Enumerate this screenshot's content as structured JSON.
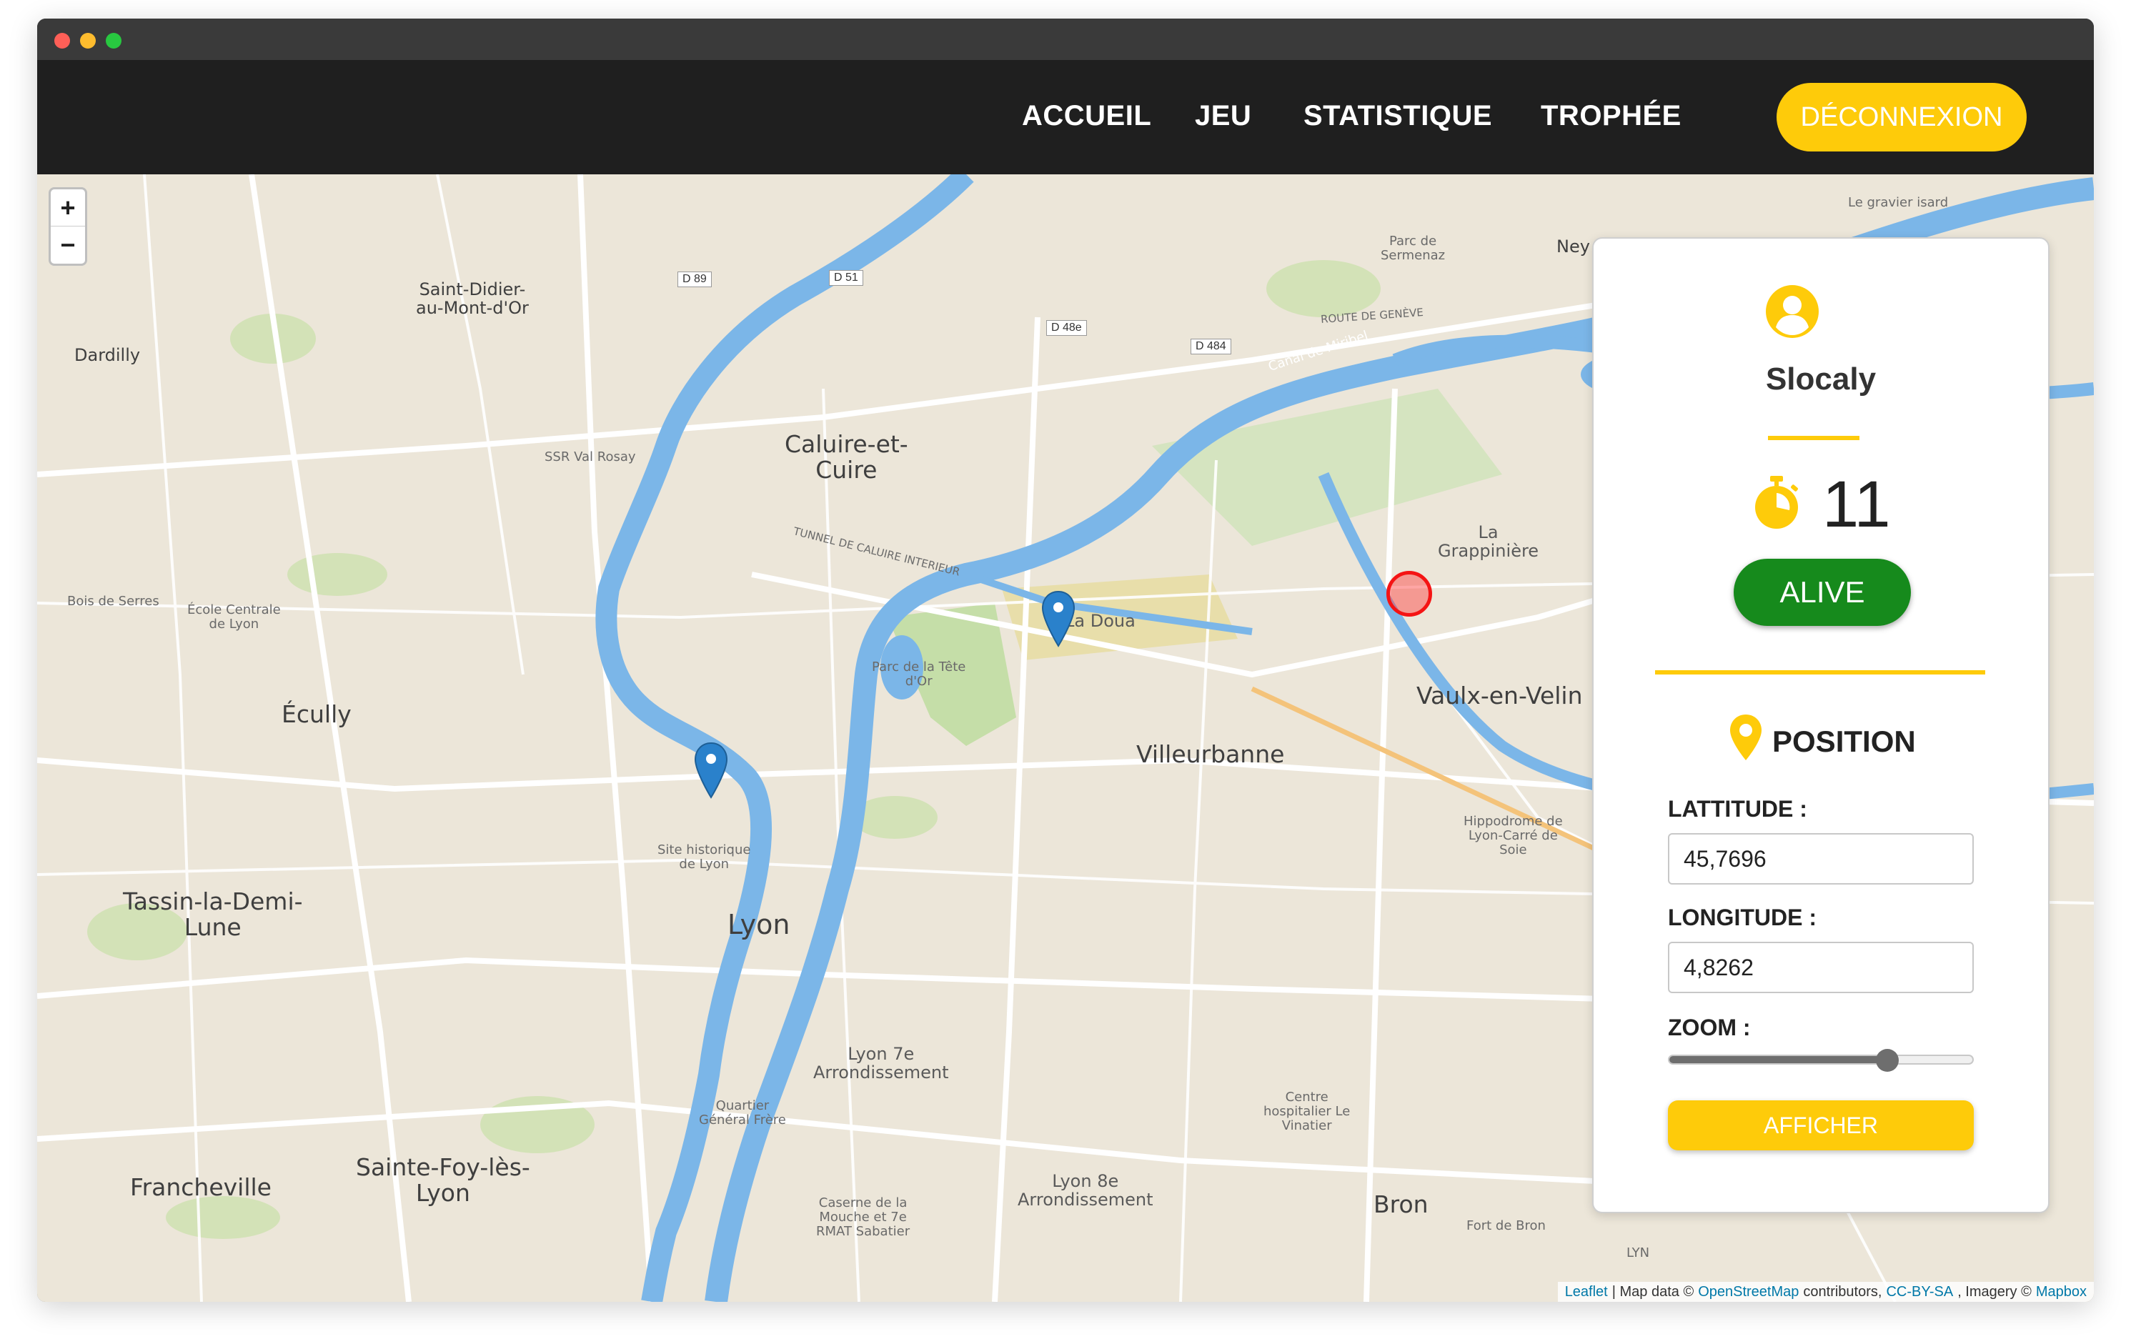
{
  "navbar": {
    "links": [
      "ACCUEIL",
      "JEU",
      "STATISTIQUE",
      "TROPHÉE"
    ],
    "logout_label": "DÉCONNEXION",
    "accent_color": "#fecb0a",
    "background_color": "#1f1f1f"
  },
  "map": {
    "zoom_in_label": "+",
    "zoom_out_label": "−",
    "labels": {
      "dardilly": "Dardilly",
      "saint_didier": "Saint-Didier-\nau-Mont-d'Or",
      "caluire": "Caluire-et-\nCuire",
      "ssr_val_rosay": "SSR Val Rosay",
      "tunnel": "TUNNEL DE CALUIRE INTERIEUR",
      "bois_de_serres": "Bois de Serres",
      "ecole_centrale": "École Centrale\nde Lyon",
      "ecully": "Écully",
      "la_doua": "La Doua",
      "parc_tete_or": "Parc de la Tête\nd'Or",
      "villeurbanne": "Villeurbanne",
      "la_grappiniere": "La\nGrappinière",
      "vaulx_en_velin": "Vaulx-en-Velin",
      "tassin": "Tassin-la-Demi-\nLune",
      "site_historique": "Site historique\nde Lyon",
      "lyon": "Lyon",
      "hippodrome": "Hippodrome de\nLyon-Carré de\nSoie",
      "lyon_7e": "Lyon 7e\nArrondissement",
      "quartier_general": "Quartier\nGénéral Frère",
      "centre_hospitalier": "Centre\nhospitalier Le\nVinatier",
      "francheville": "Francheville",
      "sainte_foy": "Sainte-Foy-lès-\nLyon",
      "lyon_8e": "Lyon 8e\nArrondissement",
      "caserne": "Caserne de la\nMouche et 7e\nRMAT Sabatier",
      "bron": "Bron",
      "fort_de_bron": "Fort de Bron",
      "lyn": "LYN",
      "parc_sermenaz": "Parc de\nSermenaz",
      "gravier_isard": "Le gravier isard",
      "route_de_geneve": "ROUTE DE GENÈVE",
      "canal_miribel": "Canal de Miribel",
      "ney": "Ney",
      "d89": "D 89",
      "d51": "D 51",
      "d48e": "D 48e",
      "d484": "D 484"
    },
    "attribution": {
      "leaflet": "Leaflet",
      "map_data": "| Map data ©",
      "osm": "OpenStreetMap",
      "contributors": "contributors,",
      "license": "CC-BY-SA",
      "imagery": ", Imagery ©",
      "mapbox": "Mapbox"
    }
  },
  "panel": {
    "username": "Slocaly",
    "score": "11",
    "status": "ALIVE",
    "status_color": "#168a1c",
    "position_title": "POSITION",
    "latitude_label": "LATTITUDE :",
    "latitude_value": "45,7696",
    "longitude_label": "LONGITUDE :",
    "longitude_value": "4,8262",
    "zoom_label": "ZOOM :",
    "zoom_fraction": 0.72,
    "show_button": "AFFICHER",
    "icons": [
      "user-circle-icon",
      "stopwatch-icon",
      "map-pin-icon"
    ]
  }
}
